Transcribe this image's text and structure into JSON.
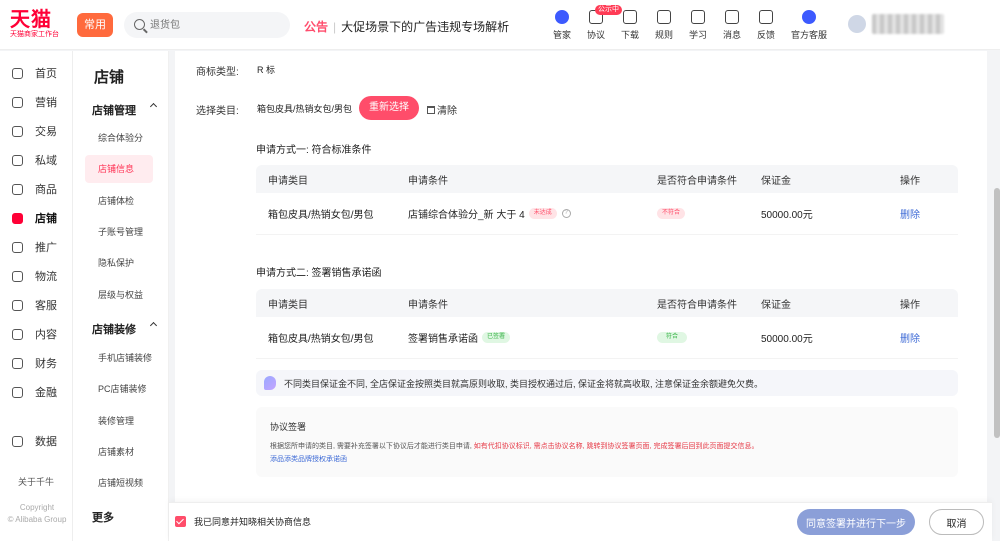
{
  "brand": {
    "name": "天猫",
    "subtitle": "天猫商家工作台",
    "color": "#ff0036"
  },
  "header": {
    "mode_label": "常用",
    "search_placeholder": "退货包",
    "notice_tag": "公告",
    "notice_text": "大促场景下的广告违规专场解析",
    "nav": [
      {
        "label": "管家",
        "icon": "butler-icon",
        "badge": ""
      },
      {
        "label": "协议",
        "icon": "agreement-icon",
        "badge": "公示中"
      },
      {
        "label": "下载",
        "icon": "download-icon",
        "badge": ""
      },
      {
        "label": "规则",
        "icon": "rules-icon",
        "badge": ""
      },
      {
        "label": "学习",
        "icon": "learn-icon",
        "badge": ""
      },
      {
        "label": "消息",
        "icon": "message-icon",
        "badge": ""
      },
      {
        "label": "反馈",
        "icon": "feedback-icon",
        "badge": ""
      },
      {
        "label": "官方客服",
        "icon": "service-icon",
        "badge": ""
      }
    ]
  },
  "sidebar": {
    "items": [
      {
        "label": "首页",
        "icon": "home-icon"
      },
      {
        "label": "营销",
        "icon": "marketing-icon"
      },
      {
        "label": "交易",
        "icon": "trade-icon"
      },
      {
        "label": "私域",
        "icon": "private-domain-icon"
      },
      {
        "label": "商品",
        "icon": "goods-icon"
      },
      {
        "label": "店铺",
        "icon": "store-icon",
        "active": true
      },
      {
        "label": "推广",
        "icon": "promotion-icon"
      },
      {
        "label": "物流",
        "icon": "logistics-icon"
      },
      {
        "label": "客服",
        "icon": "customer-service-icon"
      },
      {
        "label": "内容",
        "icon": "content-icon"
      },
      {
        "label": "财务",
        "icon": "finance-icon"
      },
      {
        "label": "金融",
        "icon": "loan-icon"
      },
      {
        "label": "数据",
        "icon": "data-icon"
      }
    ],
    "bottom_label": "关于千牛",
    "copyright_line1": "Copyright",
    "copyright_line2": "© Alibaba Group"
  },
  "submenu": {
    "title": "店铺",
    "group1": "店铺管理",
    "group1_items": [
      "综合体验分",
      "店铺信息",
      "店铺体检",
      "子账号管理",
      "隐私保护",
      "层级与权益"
    ],
    "group2": "店铺装修",
    "group2_items": [
      "手机店铺装修",
      "PC店铺装修",
      "装修管理",
      "店铺素材",
      "店铺短视频"
    ],
    "more": "更多"
  },
  "content": {
    "brand_type_label": "商标类型:",
    "brand_type_value": "R 标",
    "category_label": "选择类目:",
    "category_value": "箱包皮具/热销女包/男包",
    "reselect_label": "重新选择",
    "clear_label": "清除",
    "method1_title": "申请方式一: 符合标准条件",
    "method2_title": "申请方式二: 签署销售承诺函",
    "columns": [
      "申请类目",
      "申请条件",
      "是否符合申请条件",
      "保证金",
      "操作"
    ],
    "row1": {
      "category": "箱包皮具/热销女包/男包",
      "condition": "店铺综合体验分_新 大于 4",
      "condition_tag": "未达成",
      "meets": "不符合",
      "deposit": "50000.00元",
      "action": "删除"
    },
    "row2": {
      "category": "箱包皮具/热销女包/男包",
      "condition": "签署销售承诺函",
      "condition_tag": "已签署",
      "meets": "符合",
      "deposit": "50000.00元",
      "action": "删除"
    },
    "info_text": "不同类目保证金不同, 全店保证金按照类目就高原则收取, 类目授权通过后, 保证金将就高收取, 注意保证金余额避免欠费。",
    "agreement_title": "协议签署",
    "agreement_desc_plain": "根据您所申请的类目, 需要补充签署以下协议后才能进行类目申请, ",
    "agreement_desc_highlight": "如有代扣协议标识, 需点击协议名称, 跳转到协议签署页面, 完成签署后回到此页面提交信息。",
    "agreement_link": "添品添类品牌授权承诺函"
  },
  "footer": {
    "agree_text": "我已同意并知晓相关协商信息",
    "primary_button": "同意签署并进行下一步",
    "cancel_button": "取消"
  },
  "colors": {
    "accent": "#ff4d6a",
    "primary_button": "#8b9fd8",
    "link": "#3d6ad6"
  }
}
